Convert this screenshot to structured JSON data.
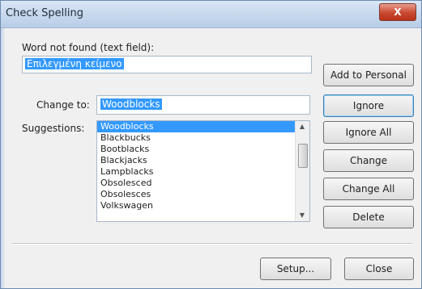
{
  "window": {
    "title": "Check Spelling",
    "close_glyph": "X"
  },
  "not_found": {
    "label": "Word not found (text field):",
    "value": "Επιλεγμένη κείμενο"
  },
  "change_to": {
    "label": "Change to:",
    "value": "Woodblocks"
  },
  "suggestions": {
    "label": "Suggestions:",
    "items": [
      "Woodblocks",
      "Blackbucks",
      "Bootblacks",
      "Blackjacks",
      "Lampblacks",
      "Obsolesced",
      "Obsolesces",
      "Volkswagen"
    ],
    "selected_index": 0
  },
  "buttons": {
    "add_to_personal": "Add to Personal",
    "ignore": "Ignore",
    "ignore_all": "Ignore All",
    "change": "Change",
    "change_all": "Change All",
    "delete": "Delete",
    "setup": "Setup...",
    "close": "Close"
  },
  "icons": {
    "close": "close-x-icon",
    "scroll_up": "triangle-up-icon",
    "scroll_down": "triangle-down-icon"
  },
  "colors": {
    "selection": "#3399ff",
    "close_button": "#c9482f",
    "title_bar": "#c8d9ef"
  }
}
